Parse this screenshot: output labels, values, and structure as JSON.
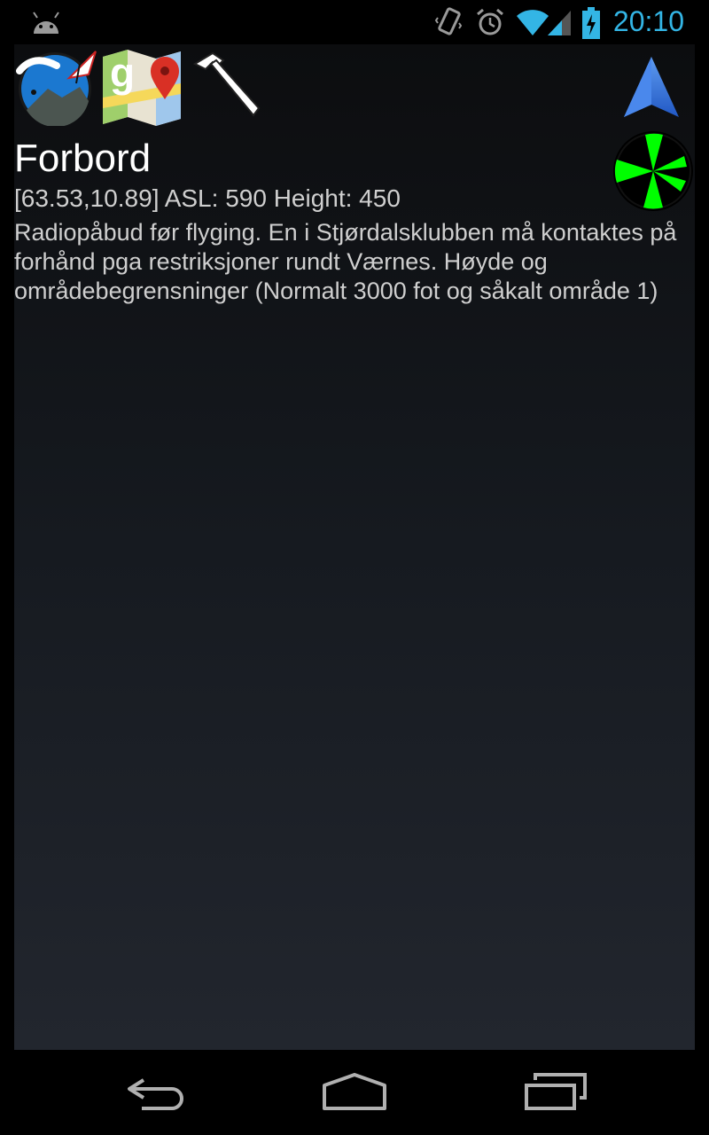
{
  "status_bar": {
    "time": "20:10",
    "icons": [
      "android-debug-icon",
      "vibrate-icon",
      "alarm-icon",
      "wifi-icon",
      "signal-icon",
      "battery-charging-icon"
    ],
    "accent_color": "#33b5e5"
  },
  "toolbar": {
    "icons": [
      "paragliding-app-icon",
      "google-maps-icon",
      "hammer-icon",
      "navigation-arrow-icon",
      "wind-direction-icon"
    ]
  },
  "site": {
    "name": "Forbord",
    "details": "[63.53,10.89] ASL: 590 Height: 450",
    "description": "Radiopåbud før flyging. En i Stjørdalsklubben må kontaktes på forhånd pga restriksjoner rundt Værnes. Høyde og områdebegrensninger (Normalt 3000 fot og såkalt område 1)"
  },
  "wind_indicator": {
    "color": "#00ff00"
  },
  "nav_bar": {
    "buttons": [
      "back-icon",
      "home-icon",
      "recent-apps-icon"
    ]
  }
}
